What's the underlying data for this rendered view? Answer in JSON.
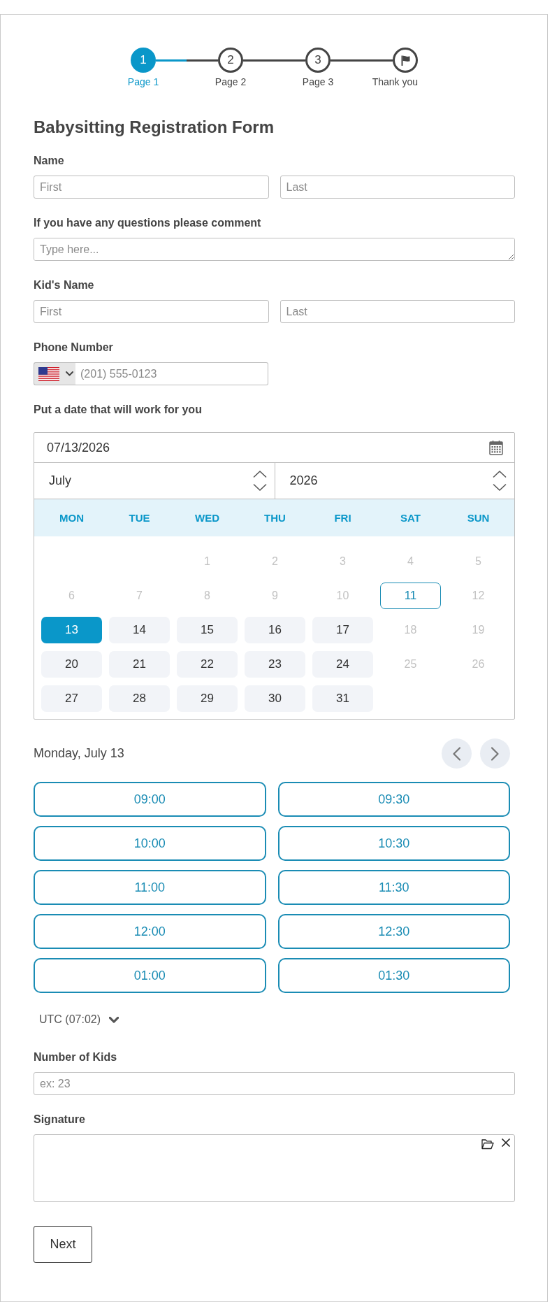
{
  "stepper": [
    {
      "kind": "number",
      "number": "1",
      "label": "Page 1",
      "selected": true
    },
    {
      "kind": "number",
      "number": "2",
      "label": "Page 2",
      "selected": false
    },
    {
      "kind": "number",
      "number": "3",
      "label": "Page 3",
      "selected": false
    },
    {
      "kind": "flag",
      "label": "Thank you",
      "selected": false
    }
  ],
  "title": "Babysitting Registration Form",
  "fields": [
    {
      "kind": "name",
      "label": "Name",
      "inputs": [
        {
          "placeholder": "First"
        },
        {
          "placeholder": "Last"
        }
      ]
    },
    {
      "kind": "textarea",
      "label": "If you have any questions please comment",
      "placeholder": "Type here..."
    },
    {
      "kind": "name",
      "label": "Kid's Name",
      "inputs": [
        {
          "placeholder": "First"
        },
        {
          "placeholder": "Last"
        }
      ]
    },
    {
      "kind": "phone",
      "label": "Phone Number",
      "placeholder": "(201) 555-0123"
    },
    {
      "kind": "date",
      "label": "Put a date that will work for you",
      "value": "07/13/2026",
      "month": "July",
      "year": "2026",
      "weekdays": [
        "MON",
        "TUE",
        "WED",
        "THU",
        "FRI",
        "SAT",
        "SUN"
      ],
      "weeks": [
        [
          {
            "day": "1",
            "available": false,
            "today": false,
            "selected": false
          },
          {
            "day": "2",
            "available": false,
            "today": false,
            "selected": false
          },
          {
            "day": "3",
            "available": false,
            "today": false,
            "selected": false
          },
          {
            "day": "4",
            "available": false,
            "today": false,
            "selected": false
          },
          {
            "day": "5",
            "available": false,
            "today": false,
            "selected": false
          }
        ],
        [
          {
            "day": "6",
            "available": false,
            "today": false,
            "selected": false
          },
          {
            "day": "7",
            "available": false,
            "today": false,
            "selected": false
          },
          {
            "day": "8",
            "available": false,
            "today": false,
            "selected": false
          },
          {
            "day": "9",
            "available": false,
            "today": false,
            "selected": false
          },
          {
            "day": "10",
            "available": false,
            "today": false,
            "selected": false
          },
          {
            "day": "11",
            "available": false,
            "today": true,
            "selected": false
          },
          {
            "day": "12",
            "available": false,
            "today": false,
            "selected": false
          }
        ],
        [
          {
            "day": "13",
            "available": true,
            "today": false,
            "selected": true
          },
          {
            "day": "14",
            "available": true,
            "today": false,
            "selected": false
          },
          {
            "day": "15",
            "available": true,
            "today": false,
            "selected": false
          },
          {
            "day": "16",
            "available": true,
            "today": false,
            "selected": false
          },
          {
            "day": "17",
            "available": true,
            "today": false,
            "selected": false
          },
          {
            "day": "18",
            "available": false,
            "today": false,
            "selected": false
          },
          {
            "day": "19",
            "available": false,
            "today": false,
            "selected": false
          }
        ],
        [
          {
            "day": "20",
            "available": true,
            "today": false,
            "selected": false
          },
          {
            "day": "21",
            "available": true,
            "today": false,
            "selected": false
          },
          {
            "day": "22",
            "available": true,
            "today": false,
            "selected": false
          },
          {
            "day": "23",
            "available": true,
            "today": false,
            "selected": false
          },
          {
            "day": "24",
            "available": true,
            "today": false,
            "selected": false
          },
          {
            "day": "25",
            "available": false,
            "today": false,
            "selected": false
          },
          {
            "day": "26",
            "available": false,
            "today": false,
            "selected": false
          }
        ],
        [
          {
            "day": "27",
            "available": true,
            "today": false,
            "selected": false
          },
          {
            "day": "28",
            "available": true,
            "today": false,
            "selected": false
          },
          {
            "day": "29",
            "available": true,
            "today": false,
            "selected": false
          },
          {
            "day": "30",
            "available": true,
            "today": false,
            "selected": false
          },
          {
            "day": "31",
            "available": true,
            "today": false,
            "selected": false
          }
        ]
      ],
      "selected_date": "Monday, July 13",
      "time_slots": [
        {
          "time": "09:00",
          "selected": false
        },
        {
          "time": "09:30",
          "selected": false
        },
        {
          "time": "10:00",
          "selected": false
        },
        {
          "time": "10:30",
          "selected": false
        },
        {
          "time": "11:00",
          "selected": false
        },
        {
          "time": "11:30",
          "selected": false
        },
        {
          "time": "12:00",
          "selected": false
        },
        {
          "time": "12:30",
          "selected": false
        },
        {
          "time": "01:00",
          "selected": false
        },
        {
          "time": "01:30",
          "selected": false
        }
      ],
      "timezone": "UTC (07:02)"
    },
    {
      "kind": "number",
      "label": "Number of Kids",
      "placeholder": "ex: 23"
    },
    {
      "kind": "signature",
      "label": "Signature"
    }
  ],
  "next_button": "Next"
}
